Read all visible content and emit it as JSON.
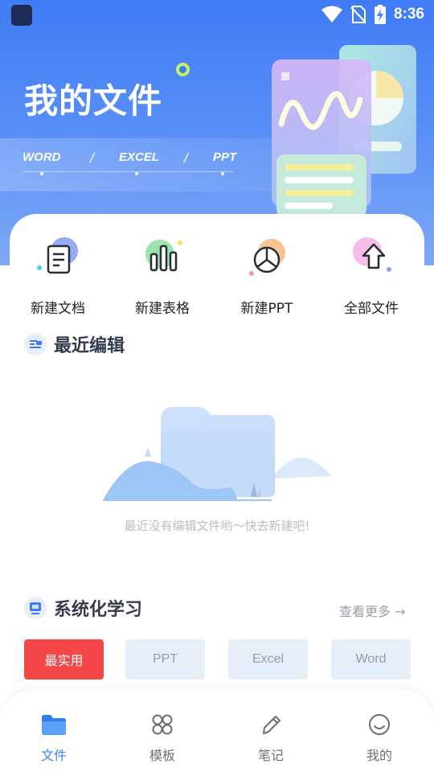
{
  "status_bar": {
    "time": "8:36"
  },
  "hero": {
    "title": "我的文件",
    "formats": [
      "WORD",
      "EXCEL",
      "PPT"
    ],
    "separator": "/"
  },
  "quick_actions": [
    {
      "label": "新建文档",
      "icon": "document-icon"
    },
    {
      "label": "新建表格",
      "icon": "bar-chart-icon"
    },
    {
      "label": "新建PPT",
      "icon": "pie-chart-icon"
    },
    {
      "label": "全部文件",
      "icon": "upload-arrow-icon"
    }
  ],
  "recent": {
    "title": "最近编辑",
    "empty_text": "最近没有编辑文件哟～快去新建吧!"
  },
  "learning": {
    "title": "系统化学习",
    "more_label": "查看更多 →",
    "tabs": [
      {
        "label": "最实用",
        "active": true
      },
      {
        "label": "PPT",
        "active": false
      },
      {
        "label": "Excel",
        "active": false
      },
      {
        "label": "Word",
        "active": false
      }
    ]
  },
  "bottom_nav": [
    {
      "label": "文件",
      "icon": "folder-icon",
      "active": true
    },
    {
      "label": "模板",
      "icon": "grid-icon",
      "active": false
    },
    {
      "label": "笔记",
      "icon": "pencil-icon",
      "active": false
    },
    {
      "label": "我的",
      "icon": "smile-icon",
      "active": false
    }
  ],
  "colors": {
    "primary": "#3f7bf5",
    "active_tab": "#f5474a",
    "inactive_tab_bg": "#e6eef9",
    "inactive_tab_text": "#8f9db2",
    "nav_active": "#3a86f5",
    "nav_inactive": "#6b6f77"
  }
}
